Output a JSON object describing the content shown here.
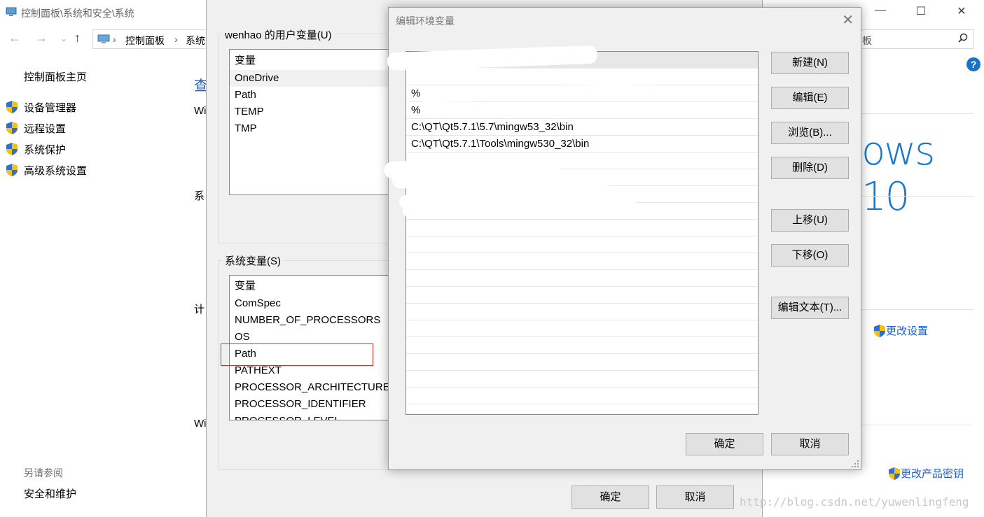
{
  "control_panel": {
    "title": "控制面板\\系统和安全\\系统",
    "breadcrumb": [
      "控制面板",
      "系统"
    ],
    "search_placeholder": "板",
    "left_pane": {
      "home": "控制面板主页",
      "links": [
        "设备管理器",
        "远程设置",
        "系统保护",
        "高级系统设置"
      ],
      "see_also": "另请参阅",
      "security": "安全和维护"
    },
    "mid_fragments": [
      "查",
      "Wi",
      "系",
      "计",
      "Wi"
    ],
    "right_pane": {
      "windows_logo_text": "ows 10",
      "change_settings": "更改设置",
      "change_product_key": "更改产品密钥"
    }
  },
  "env_dialog": {
    "user_group_label": "wenhao 的用户变量(U)",
    "user_vars_header": "变量",
    "user_vars": [
      "OneDrive",
      "Path",
      "TEMP",
      "TMP"
    ],
    "system_group_label": "系统变量(S)",
    "system_vars_header": "变量",
    "system_vars": [
      "ComSpec",
      "NUMBER_OF_PROCESSORS",
      "OS",
      "Path",
      "PATHEXT",
      "PROCESSOR_ARCHITECTURE",
      "PROCESSOR_IDENTIFIER",
      "PROCESSOR_LEVEL"
    ],
    "ok_label": "确定",
    "cancel_label": "取消"
  },
  "edit_dialog": {
    "title": "编辑环境变量",
    "paths": [
      "",
      "",
      "%",
      "%",
      "C:\\QT\\Qt5.7.1\\5.7\\mingw53_32\\bin",
      "C:\\QT\\Qt5.7.1\\Tools\\mingw530_32\\bin",
      "",
      "",
      "",
      ""
    ],
    "buttons": {
      "new": "新建(N)",
      "edit": "编辑(E)",
      "browse": "浏览(B)...",
      "delete": "删除(D)",
      "move_up": "上移(U)",
      "move_down": "下移(O)",
      "edit_text": "编辑文本(T)..."
    },
    "ok_label": "确定",
    "cancel_label": "取消"
  },
  "watermark": "http://blog.csdn.net/yuwenlingfeng",
  "colors": {
    "accent": "#1979ca",
    "highlight_box": "#ee2222"
  }
}
